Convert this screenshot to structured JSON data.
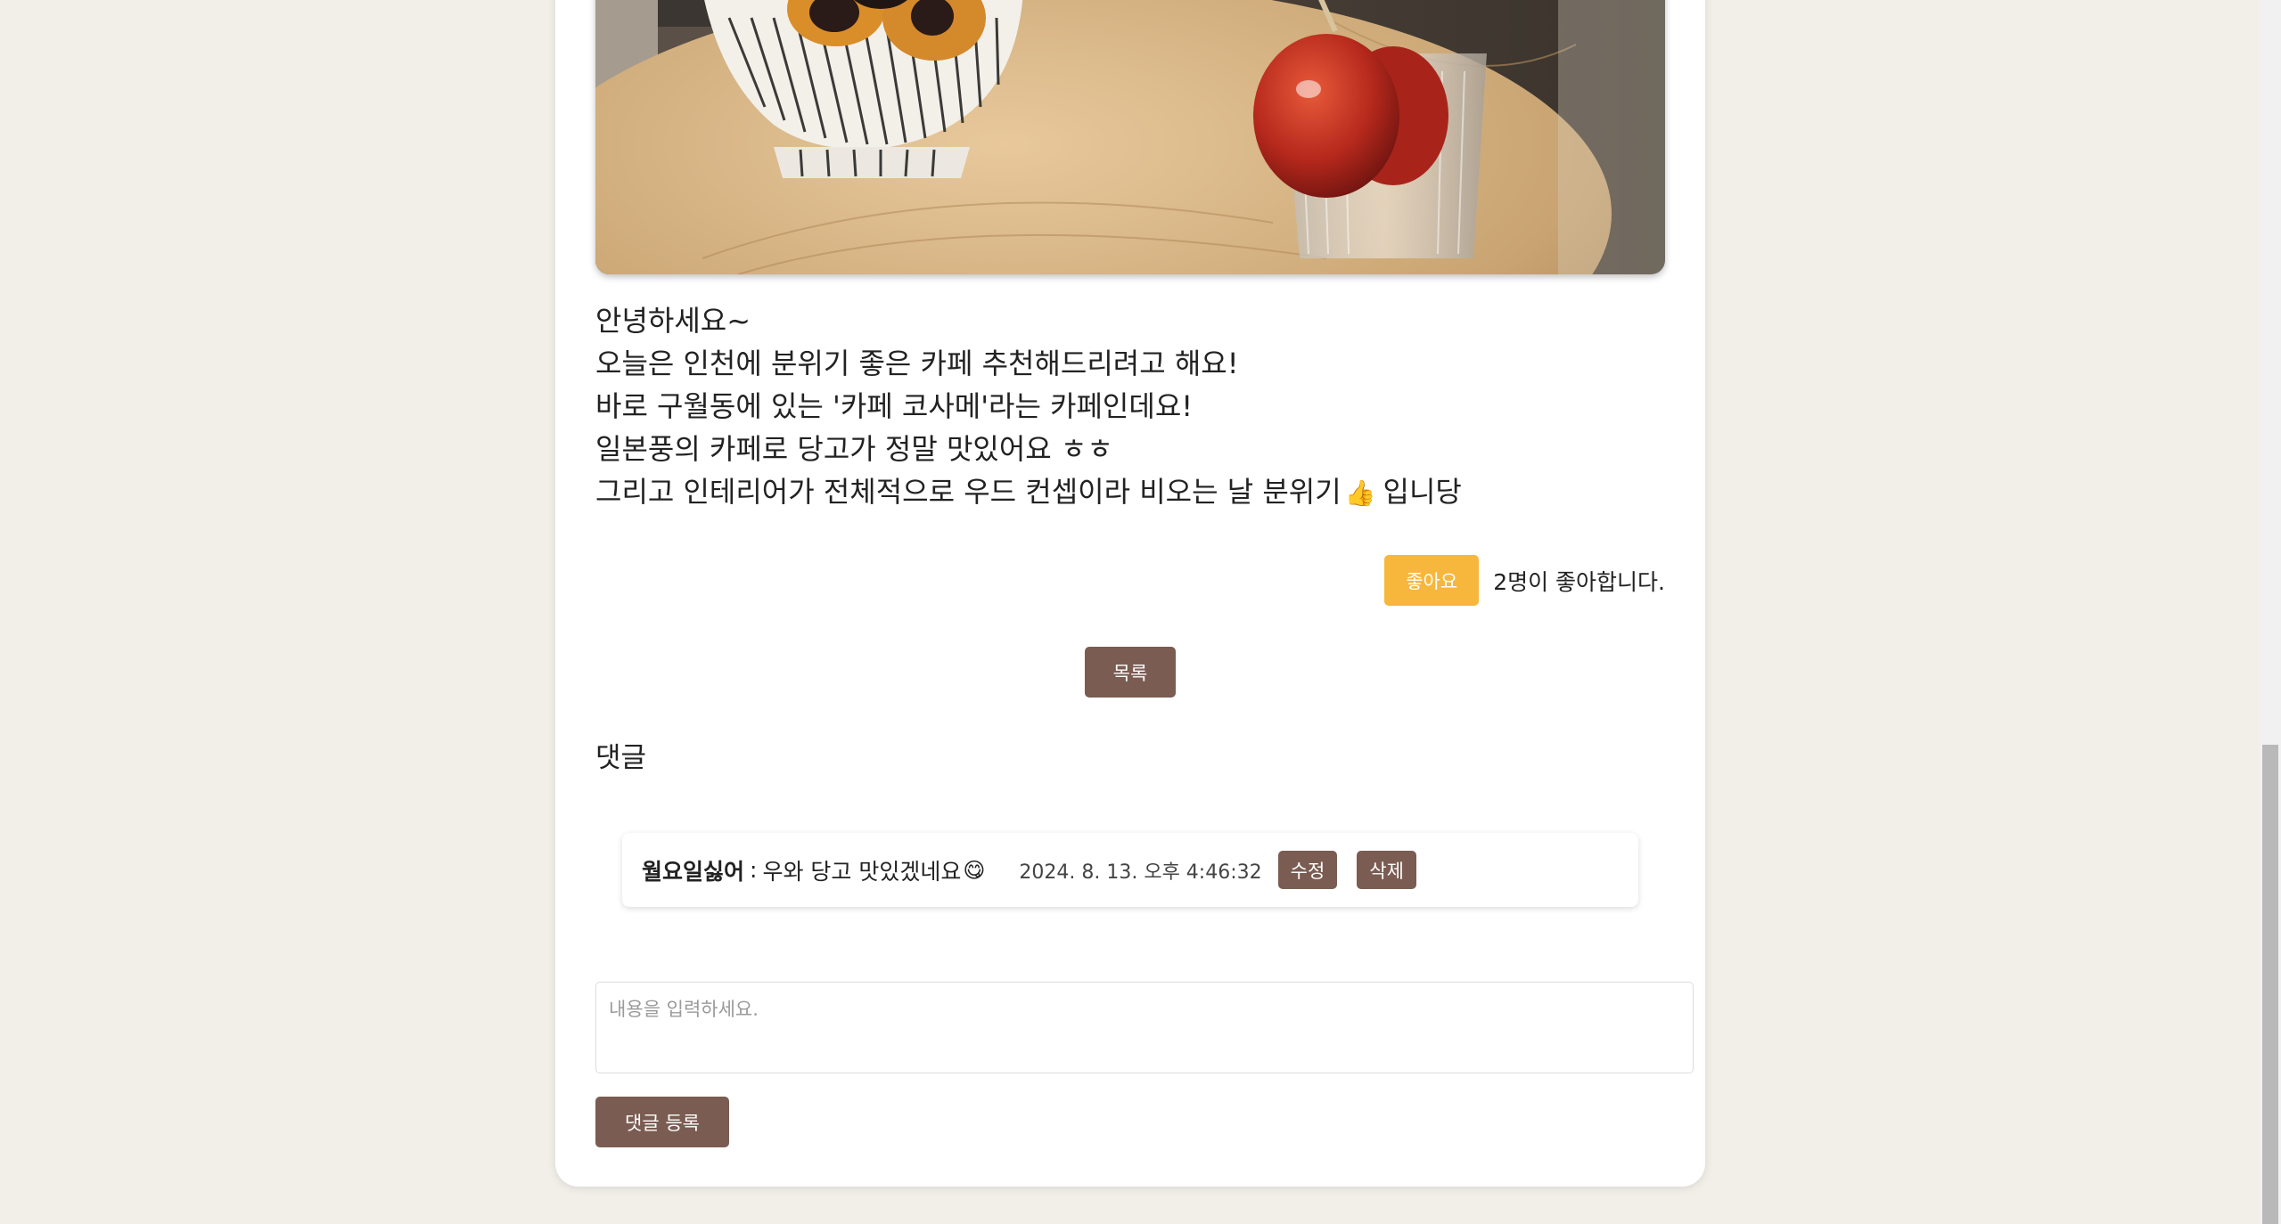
{
  "post": {
    "body_lines": [
      "안녕하세요~",
      "오늘은 인천에 분위기 좋은 카페 추천해드리려고 해요!",
      "바로 구월동에 있는 '카페 코사메'라는 카페인데요!",
      "일본풍의 카페로 당고가 정말 맛있어요 ㅎㅎ"
    ],
    "last_line_before": "그리고 인테리어가 전체적으로 우드 컨셉이라 비오는 날 분위기",
    "last_line_emoji": "👍",
    "last_line_after": "입니당"
  },
  "like": {
    "button_label": "좋아요",
    "count_text": "2명이 좋아합니다."
  },
  "list_button_label": "목록",
  "comments": {
    "title": "댓글",
    "items": [
      {
        "author": "월요일싫어",
        "separator": ":",
        "text": "우와 당고 맛있겠네요",
        "emoji": "😋",
        "date": "2024. 8. 13. 오후 4:46:32",
        "edit_label": "수정",
        "delete_label": "삭제"
      }
    ],
    "input_placeholder": "내용을 입력하세요.",
    "submit_label": "댓글 등록"
  },
  "colors": {
    "background": "#f2efe9",
    "like_button": "#f6b73c",
    "brown_button": "#7a5c52"
  }
}
